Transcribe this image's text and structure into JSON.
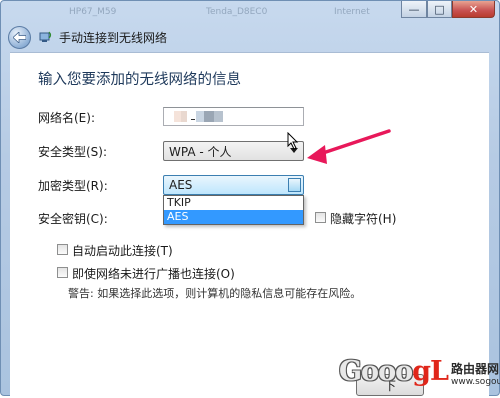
{
  "window": {
    "title": "手动连接到无线网络",
    "controls": {
      "minimize": "—",
      "maximize": "□",
      "close": "✕"
    },
    "background_blur": [
      "HP67_M59",
      "Tenda_D8EC0",
      "Internet"
    ]
  },
  "form": {
    "heading": "输入您要添加的无线网络的信息",
    "network_name_label": "网络名(E):",
    "network_name_value": "",
    "security_type_label": "安全类型(S):",
    "security_type_value": "WPA - 个人",
    "encryption_type_label": "加密类型(R):",
    "encryption_type_value": "AES",
    "encryption_options": [
      "TKIP",
      "AES"
    ],
    "encryption_selected_index": 1,
    "security_key_label": "安全密钥(C):",
    "hide_chars_label": "隐藏字符(H)",
    "auto_start_label": "自动启动此连接(T)",
    "connect_hidden_label": "即使网络未进行广播也连接(O)",
    "warning_text": "警告: 如果选择此选项，则计算机的隐私信息可能存在风险。",
    "next_button": "下"
  },
  "watermark": {
    "logo_text": "Gooo",
    "logo_accent": "gL",
    "site_cn": "路由器网",
    "site_url": "www.sogou.com"
  },
  "colors": {
    "accent_arrow": "#e8185a",
    "selection": "#3399ff",
    "heading": "#1e395b"
  }
}
